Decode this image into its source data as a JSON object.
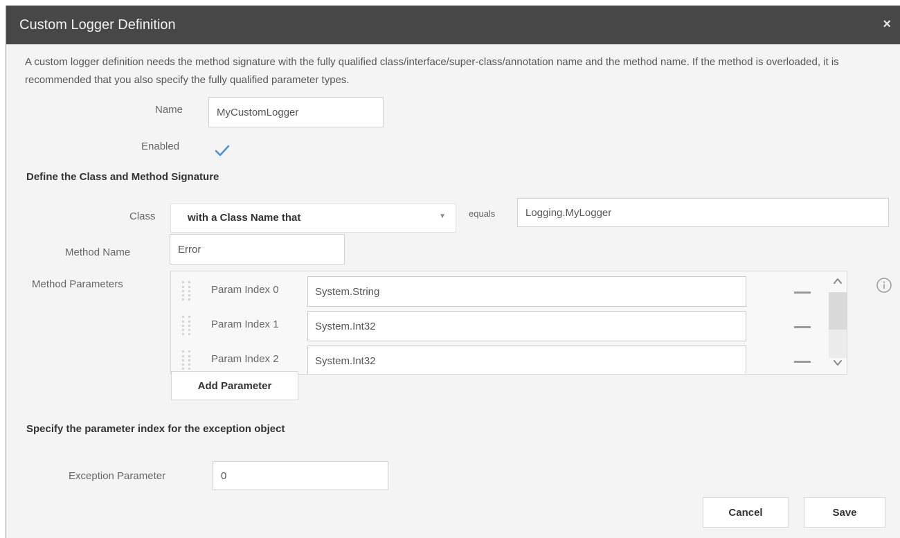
{
  "dialog": {
    "title": "Custom Logger Definition",
    "close_glyph": "×",
    "description": "A custom logger definition needs the method signature with the fully qualified class/interface/super-class/annotation name and the method name. If the method is overloaded, it is recommended that you also specify the fully qualified parameter types."
  },
  "name_field": {
    "label": "Name",
    "value": "MyCustomLogger"
  },
  "enabled_field": {
    "label": "Enabled",
    "checked": true
  },
  "signature_section": {
    "heading": "Define the Class and Method Signature",
    "class_label": "Class",
    "class_match": "with a Class Name that",
    "operator": "equals",
    "class_value": "Logging.MyLogger",
    "method_label": "Method Name",
    "method_value": "Error",
    "parameters_label": "Method Parameters",
    "parameters": [
      {
        "label": "Param Index 0",
        "value": "System.String"
      },
      {
        "label": "Param Index 1",
        "value": "System.Int32"
      },
      {
        "label": "Param Index 2",
        "value": "System.Int32"
      }
    ],
    "add_parameter": "Add Parameter"
  },
  "exception_section": {
    "heading": "Specify the parameter index for the exception object",
    "label": "Exception Parameter",
    "value": "0"
  },
  "footer": {
    "cancel": "Cancel",
    "save": "Save"
  },
  "icons": [
    "close-icon",
    "checkmark-icon",
    "chevron-down-icon",
    "drag-handle-icon",
    "remove-icon",
    "scroll-up-icon",
    "scroll-down-icon",
    "info-icon"
  ],
  "colors": {
    "titlebar": "#474747",
    "dialog_bg": "#f4f4f4",
    "check": "#4a90d9"
  }
}
